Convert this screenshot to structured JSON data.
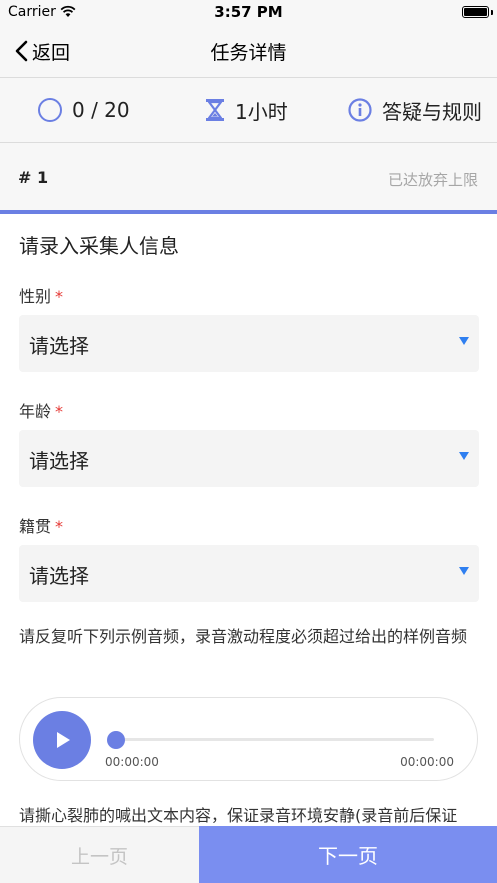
{
  "status_bar": {
    "carrier": "Carrier",
    "time": "3:57 PM"
  },
  "nav": {
    "back_label": "返回",
    "title": "任务详情"
  },
  "info_bar": {
    "progress": "0 / 20",
    "duration": "1小时",
    "rules": "答疑与规则"
  },
  "task": {
    "number": "# 1",
    "limit_text": "已达放弃上限"
  },
  "form": {
    "section_title": "请录入采集人信息",
    "required_mark": "*",
    "fields": [
      {
        "label": "性别",
        "value": "请选择"
      },
      {
        "label": "年龄",
        "value": "请选择"
      },
      {
        "label": "籍贯",
        "value": "请选择"
      }
    ]
  },
  "instruction_1": "请反复听下列示例音频，录音激动程度必须超过给出的样例音频",
  "player": {
    "current_time": "00:00:00",
    "total_time": "00:00:00",
    "progress": 0
  },
  "instruction_2": "请撕心裂肺的喊出文本内容，保证录音环境安静(录音前后保证",
  "footer": {
    "prev_label": "上一页",
    "next_label": "下一页"
  },
  "colors": {
    "accent": "#6b7fe3",
    "next_button": "#7a8ef0",
    "required": "#e53935",
    "select_arrow": "#2f7ff0"
  },
  "icons": [
    "wifi-icon",
    "battery-icon",
    "back-chevron-icon",
    "progress-circle-icon",
    "hourglass-icon",
    "info-icon",
    "dropdown-arrow-icon",
    "play-icon"
  ]
}
